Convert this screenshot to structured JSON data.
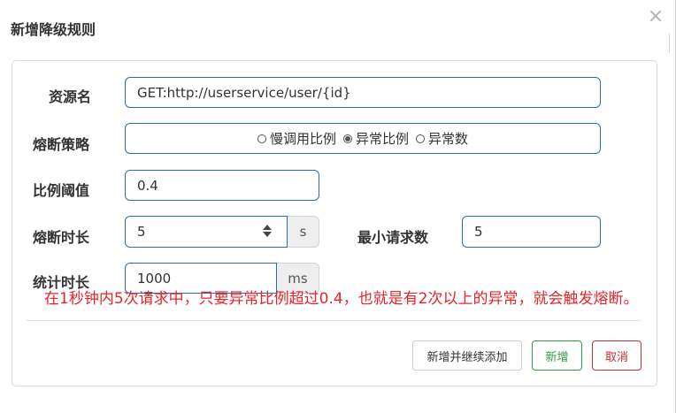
{
  "dialog": {
    "title": "新增降级规则",
    "close_glyph": "×"
  },
  "form": {
    "resource": {
      "label": "资源名",
      "value": "GET:http://userservice/user/{id}"
    },
    "strategy": {
      "label": "熔断策略",
      "options": [
        {
          "label": "慢调用比例",
          "checked": false
        },
        {
          "label": "异常比例",
          "checked": true
        },
        {
          "label": "异常数",
          "checked": false
        }
      ]
    },
    "threshold": {
      "label": "比例阈值",
      "value": "0.4"
    },
    "duration": {
      "label": "熔断时长",
      "value": "5",
      "unit": "s"
    },
    "min_requests": {
      "label": "最小请求数",
      "value": "5"
    },
    "stat_duration": {
      "label": "统计时长",
      "value": "1000",
      "unit": "ms"
    }
  },
  "annotation": {
    "text": "在1秒钟内5次请求中，只要异常比例超过0.4，也就是有2次以上的异常，就会触发熔断。",
    "color": "#e8242a"
  },
  "buttons": {
    "add_continue": "新增并继续添加",
    "add": "新增",
    "cancel": "取消"
  }
}
